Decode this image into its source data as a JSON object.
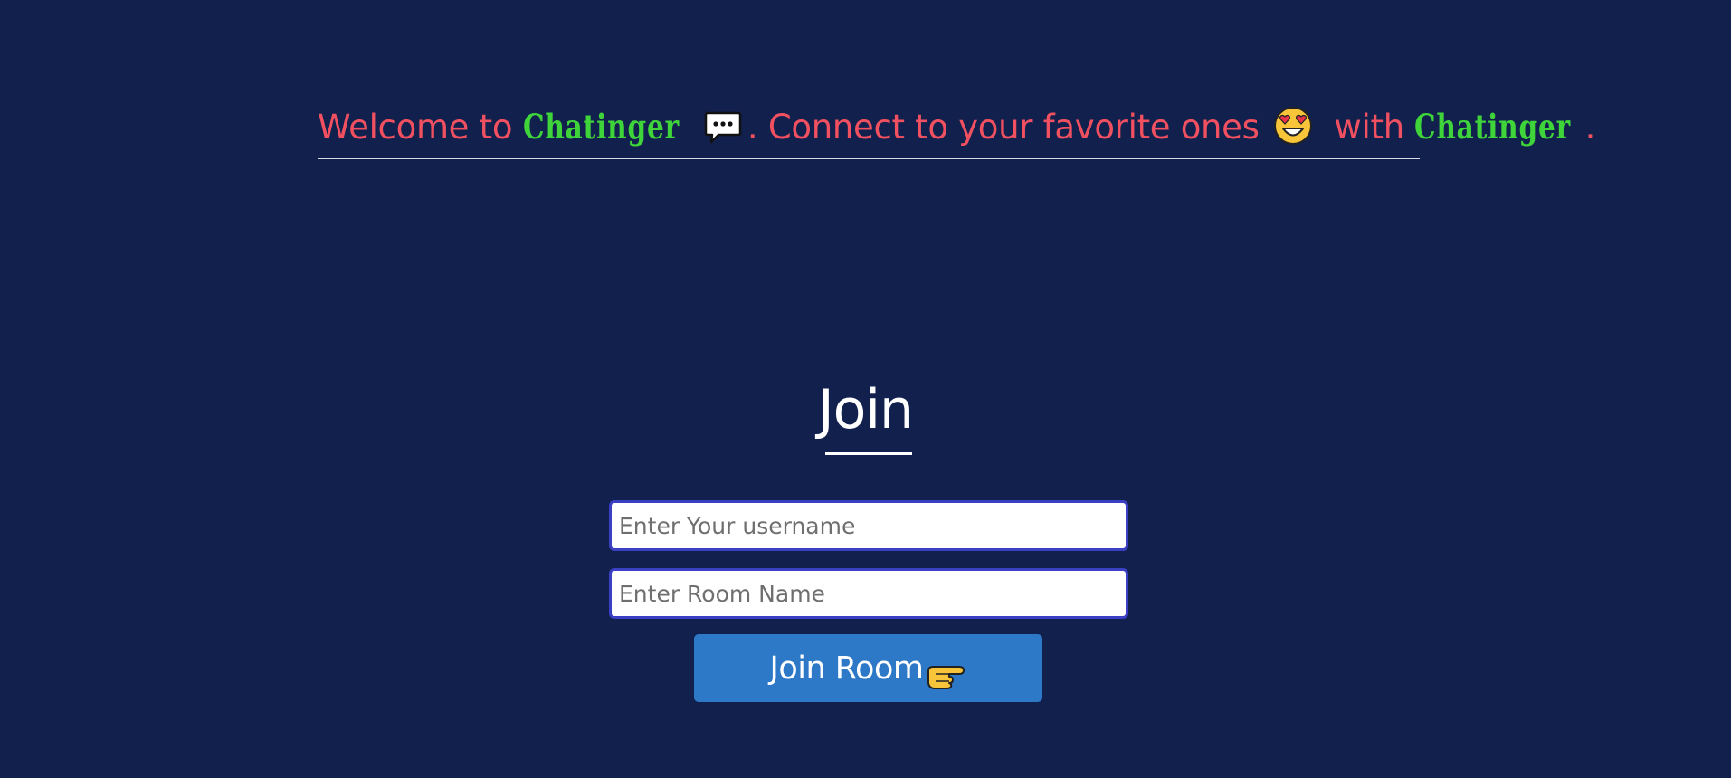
{
  "banner": {
    "welcome_prefix": "Welcome to ",
    "brand_name": "Chatinger",
    "connect_text": ". Connect to your favorite ones ",
    "with_text": " with ",
    "brand_name_2": "Chatinger",
    "end_period": ".",
    "text_color": "#f05060",
    "brand_color": "#3ed43a"
  },
  "join": {
    "heading": "Join",
    "username_placeholder": "Enter Your username",
    "room_placeholder": "Enter Room Name",
    "button_label": "Join Room"
  },
  "icons": {
    "speech": "speech-balloon-icon",
    "face": "heart-eyes-face-icon",
    "pointer": "pointing-right-hand-icon"
  },
  "colors": {
    "background": "#12204d",
    "button": "#2d78c7",
    "input_border": "#3a3fc4"
  }
}
